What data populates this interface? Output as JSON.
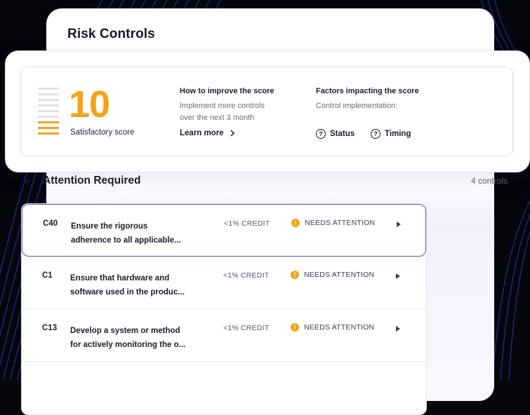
{
  "panel": {
    "title": "Risk Controls"
  },
  "score": {
    "value": "10",
    "label": "Satisfactory score",
    "level": 0.2
  },
  "improve": {
    "heading": "How to improve the score",
    "text_line1": "Implement more controls",
    "text_line2": "over the next 3 month",
    "link": "Learn more"
  },
  "factors": {
    "heading": "Factors impacting the score",
    "text": "Control implementation:",
    "status": "Status",
    "timing": "Timing"
  },
  "section": {
    "title": "Attention Required",
    "count": "4 controls"
  },
  "rows": [
    {
      "id": "C40",
      "desc_line1": "Ensure the rigorous",
      "desc_line2": "adherence to all applicable...",
      "credit": "<1% CREDIT",
      "status": "NEEDS ATTENTION"
    },
    {
      "id": "C1",
      "desc_line1": "Ensure that hardware and",
      "desc_line2": "software used in the produc...",
      "credit": "<1% CREDIT",
      "status": "NEEDS ATTENTION"
    },
    {
      "id": "C13",
      "desc_line1": "Develop a system or method",
      "desc_line2": "for actively monitoring the o...",
      "credit": "<1% CREDIT",
      "status": "NEEDS ATTENTION"
    }
  ],
  "colors": {
    "accent": "#f5a314",
    "active_border": "#5c55d4",
    "background": "#05060c"
  },
  "icons": {
    "learn_more": "chevron-right-icon",
    "factor": "question-circle-icon",
    "section": "chevron-down-icon",
    "status": "warning-icon",
    "row_action": "play-icon"
  }
}
